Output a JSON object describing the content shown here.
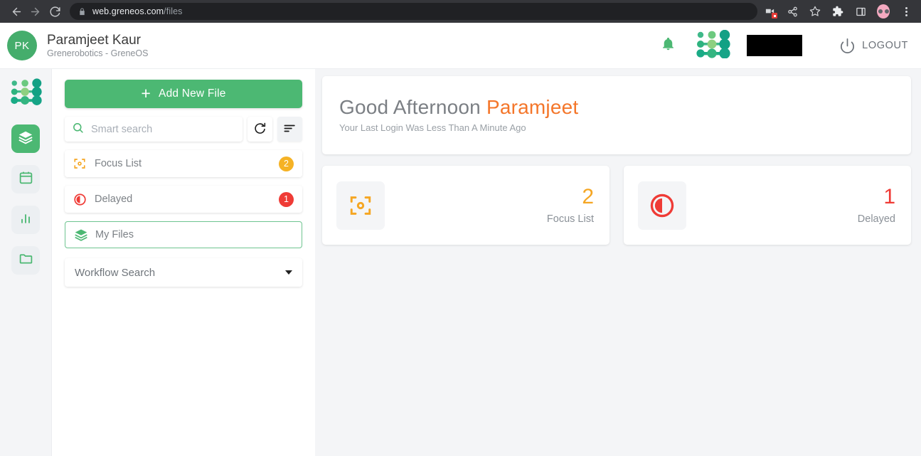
{
  "browser": {
    "back_icon": "back-arrow-icon",
    "forward_icon": "forward-arrow-icon",
    "reload_icon": "reload-icon",
    "lock_icon": "lock-icon",
    "url_domain": "web.greneos.com",
    "url_path": "/files",
    "icons": [
      "screen-record-icon",
      "share-icon",
      "bookmark-star-icon",
      "extensions-puzzle-icon",
      "side-panel-icon",
      "profile-avatar-icon",
      "kebab-menu-icon"
    ]
  },
  "header": {
    "avatar_initials": "PK",
    "user_name": "Paramjeet Kaur",
    "user_org": "Grenerobotics - GreneOS",
    "notification_icon": "bell-icon",
    "brand_logo": "greneos-logo",
    "logout_label": "LOGOUT",
    "logout_icon": "power-icon"
  },
  "rail": {
    "logo": "greneos-logo",
    "items": [
      {
        "icon": "layers-icon",
        "name": "files",
        "active": true
      },
      {
        "icon": "calendar-icon",
        "name": "calendar",
        "active": false
      },
      {
        "icon": "bar-chart-icon",
        "name": "analytics",
        "active": false
      },
      {
        "icon": "folder-icon",
        "name": "folders",
        "active": false
      }
    ]
  },
  "left_panel": {
    "add_button_label": "Add New File",
    "add_button_icon": "plus-icon",
    "search_placeholder": "Smart search",
    "search_value": "",
    "search_icon": "search-icon",
    "refresh_icon": "refresh-icon",
    "sort_icon": "sort-filter-icon",
    "nav_items": [
      {
        "label": "Focus List",
        "icon": "focus-scan-icon",
        "badge": "2",
        "badge_color": "#f5b225",
        "active": false
      },
      {
        "label": "Delayed",
        "icon": "delayed-clock-icon",
        "badge": "1",
        "badge_color": "#ef3b36",
        "active": false
      },
      {
        "label": "My Files",
        "icon": "layers-icon",
        "badge": "",
        "badge_color": "",
        "active": true
      }
    ],
    "workflow_dropdown": {
      "label": "Workflow Search",
      "chevron_icon": "chevron-down-icon"
    }
  },
  "main": {
    "greeting_prefix": "Good Afternoon",
    "greeting_name": "Paramjeet",
    "last_login": "Your Last Login Was Less Than A Minute Ago",
    "stats": [
      {
        "value": "2",
        "label": "Focus List",
        "icon": "focus-scan-icon",
        "color": "#f5a623"
      },
      {
        "value": "1",
        "label": "Delayed",
        "icon": "delayed-clock-icon",
        "color": "#ef3b36"
      }
    ]
  },
  "colors": {
    "brand_green": "#4cb873",
    "accent_orange": "#f4762a",
    "amber": "#f5b225",
    "red": "#ef3b36",
    "page_bg": "#f4f5f7"
  }
}
